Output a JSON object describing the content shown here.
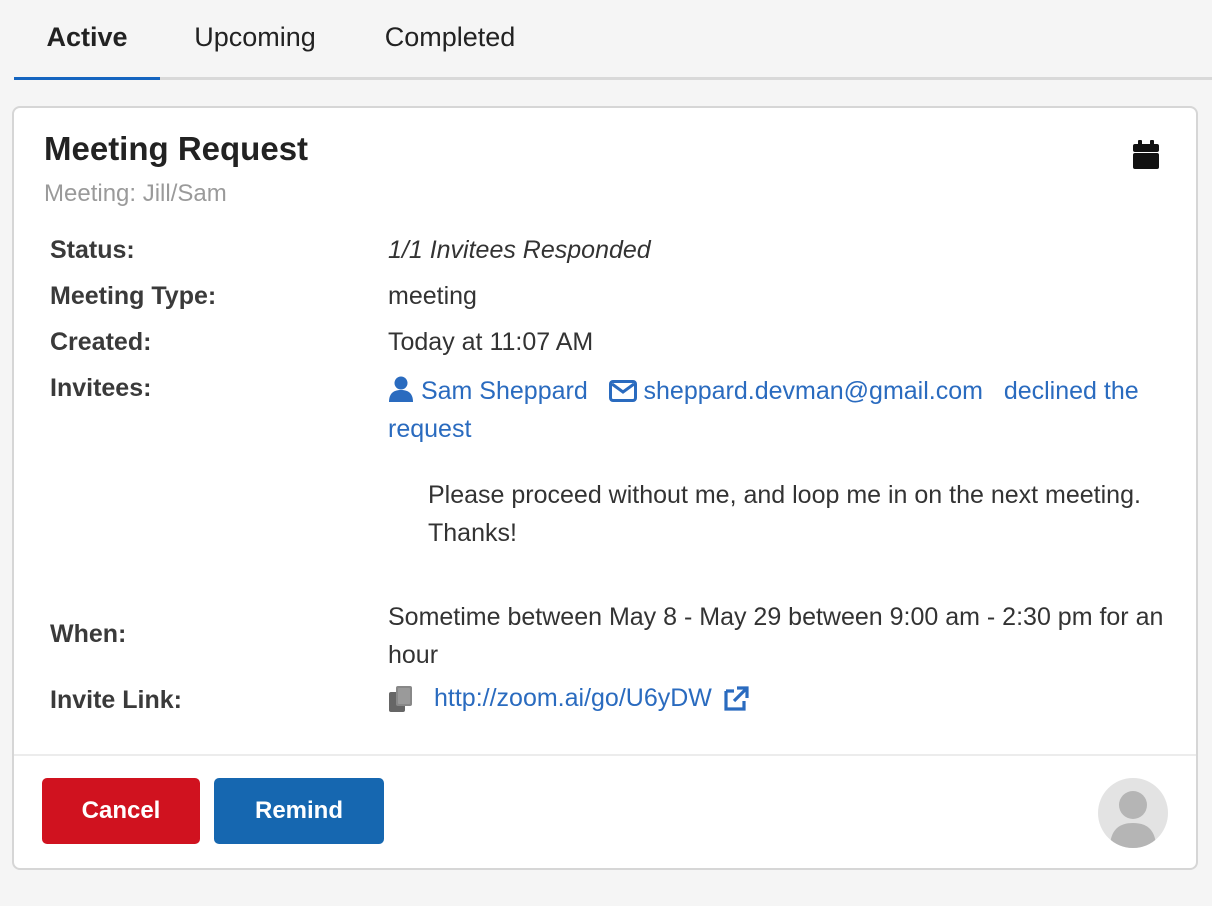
{
  "tabs": [
    {
      "label": "Active",
      "active": true
    },
    {
      "label": "Upcoming",
      "active": false
    },
    {
      "label": "Completed",
      "active": false
    }
  ],
  "card": {
    "title": "Meeting Request",
    "subtitle": "Meeting: Jill/Sam",
    "icon": "calendar-icon",
    "fields": {
      "status_label": "Status:",
      "status_value": "1/1 Invitees Responded",
      "type_label": "Meeting Type:",
      "type_value": "meeting",
      "created_label": "Created:",
      "created_value": "Today at 11:07 AM",
      "invitees_label": "Invitees:",
      "when_label": "When:",
      "when_value": "Sometime between May 8 - May 29 between 9:00 am - 2:30 pm for an hour",
      "link_label": "Invite Link:",
      "link_value": "http://zoom.ai/go/U6yDW"
    },
    "invitee": {
      "name": "Sam Sheppard",
      "email": "sheppard.devman@gmail.com",
      "response": "declined the request",
      "message": "Please proceed without me, and loop me in on the next meeting. Thanks!"
    },
    "buttons": {
      "cancel": "Cancel",
      "remind": "Remind"
    }
  },
  "colors": {
    "accent": "#1565c0",
    "link": "#2a6bbf",
    "cancel": "#d0121f",
    "remind": "#1667b0"
  }
}
